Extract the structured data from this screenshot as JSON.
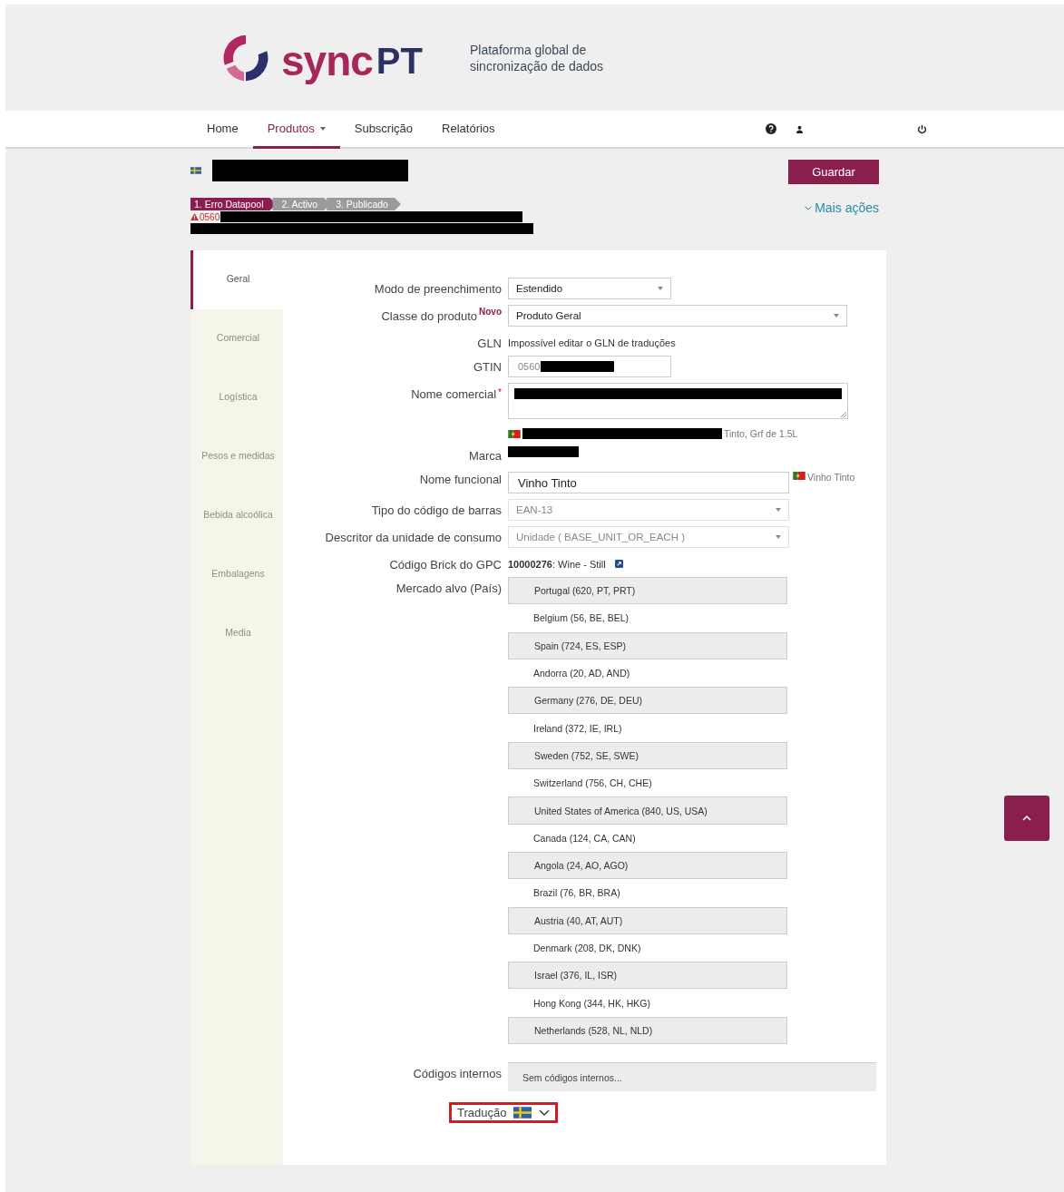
{
  "header": {
    "logo_word": "sync",
    "logo_suffix": "PT",
    "tagline": "Plataforma global de sincronização de dados"
  },
  "nav": [
    {
      "label": "Home",
      "selected": false,
      "dropdown": false
    },
    {
      "label": "Produtos",
      "selected": true,
      "dropdown": true
    },
    {
      "label": "Subscrição",
      "selected": false,
      "dropdown": false
    },
    {
      "label": "Relatórios",
      "selected": false,
      "dropdown": false
    }
  ],
  "product": {
    "save_button": "Guardar",
    "more_actions": "Mais ações",
    "error_code": "0560",
    "steps": [
      {
        "label": "1. Erro Datapool",
        "selected": true
      },
      {
        "label": "2. Activo",
        "selected": false
      },
      {
        "label": "3. Publicado",
        "selected": false
      }
    ]
  },
  "tabs": [
    {
      "label": "Geral",
      "selected": true
    },
    {
      "label": "Comercial",
      "selected": false
    },
    {
      "label": "Logística",
      "selected": false
    },
    {
      "label": "Pesos e medidas",
      "selected": false
    },
    {
      "label": "Bebida alcoólica",
      "selected": false
    },
    {
      "label": "Embalagens",
      "selected": false
    },
    {
      "label": "Media",
      "selected": false
    }
  ],
  "form": [
    {
      "kind": "select-short",
      "label": "Modo de preenchimento",
      "value": "Estendido",
      "disabled": false
    },
    {
      "kind": "select",
      "label": "Classe do produto",
      "badge": "Novo",
      "value": "Produto Geral",
      "disabled": false
    },
    {
      "kind": "text",
      "label": "GLN",
      "value": "Impossível editar o GLN de traduções"
    },
    {
      "kind": "input",
      "label": "GTIN",
      "value": "0560",
      "redacted": true
    },
    {
      "kind": "textarea",
      "label": "Nome comercial",
      "required_mark": "*",
      "redacted": true,
      "translation": "Tinto, Grf de 1.5L"
    },
    {
      "kind": "text",
      "label": "Marca",
      "redacted": true
    },
    {
      "kind": "input-translated",
      "label": "Nome funcional",
      "value": "Vinho Tinto",
      "translation": "Vinho Tinto"
    },
    {
      "kind": "select",
      "label": "Tipo do código de barras",
      "value": "EAN-13",
      "disabled": true
    },
    {
      "kind": "select",
      "label": "Descritor da unidade de consumo",
      "value": "Unidade ( BASE_UNIT_OR_EACH )",
      "disabled": true
    },
    {
      "kind": "gpc",
      "label": "Código Brick do GPC",
      "code": "10000276",
      "value": ": Wine - Still"
    },
    {
      "kind": "list",
      "label": "Mercado alvo (País)",
      "items": [
        "Portugal (620, PT, PRT)",
        "Belgium (56, BE, BEL)",
        "Spain (724, ES, ESP)",
        "Andorra (20, AD, AND)",
        "Germany (276, DE, DEU)",
        "Ireland (372, IE, IRL)",
        "Sweden (752, SE, SWE)",
        "Switzerland (756, CH, CHE)",
        "United States of America (840, US, USA)",
        "Canada (124, CA, CAN)",
        "Angola (24, AO, AGO)",
        "Brazil (76, BR, BRA)",
        "Austria (40, AT, AUT)",
        "Denmark (208, DK, DNK)",
        "Israel (376, IL, ISR)",
        "Hong Kong (344, HK, HKG)",
        "Netherlands (528, NL, NLD)"
      ]
    },
    {
      "kind": "placeholder",
      "label": "Códigos internos",
      "placeholder": "Sem códigos internos..."
    }
  ],
  "translation": {
    "label": "Tradução"
  }
}
